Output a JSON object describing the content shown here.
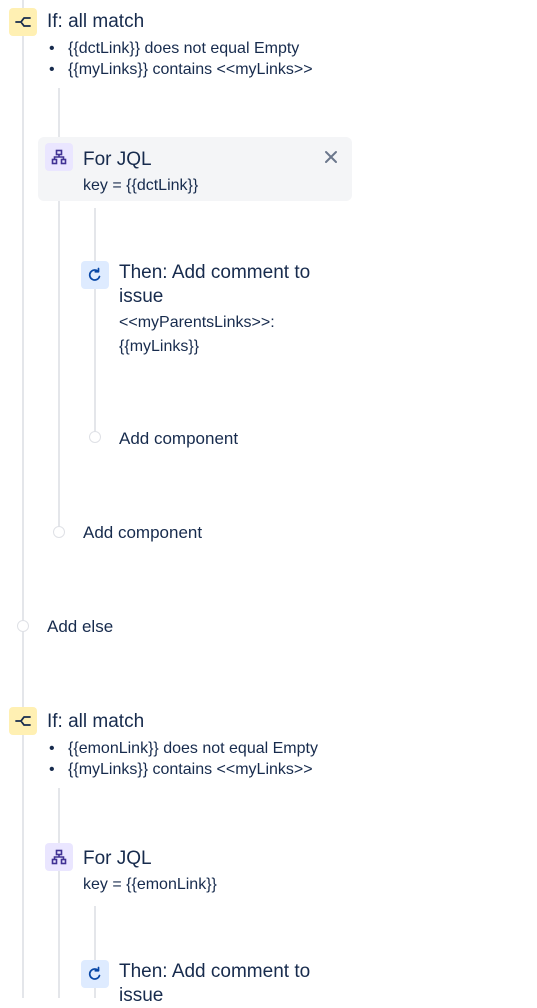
{
  "block1": {
    "title": "If: all match",
    "conditions": [
      "{{dctLink}} does not equal Empty",
      "{{myLinks}} contains <<myLinks>>"
    ],
    "for_title": "For JQL",
    "for_sub": "key = {{dctLink}}",
    "then_title_1": "Then: Add comment to",
    "then_title_2": "issue",
    "then_body_1": "<<myParentsLinks>>:",
    "then_body_2": "{{myLinks}}",
    "add_component_inner": "Add component",
    "add_component_outer": "Add component",
    "add_else": "Add else"
  },
  "block2": {
    "title": "If: all match",
    "conditions": [
      "{{emonLink}} does not equal Empty",
      "{{myLinks}} contains <<myLinks>>"
    ],
    "for_title": "For JQL",
    "for_sub": "key = {{emonLink}}",
    "then_title_1": "Then: Add comment to",
    "then_title_2": "issue"
  },
  "icons": {
    "condition": "branch-condition-icon",
    "for": "hierarchy-icon",
    "action": "refresh-action-icon",
    "close": "close-icon"
  },
  "colors": {
    "condition_bg": "#fff0b3",
    "for_bg": "#eae6ff",
    "action_bg": "#deebff",
    "selected_bg": "#f4f5f7",
    "line": "#e4e6ea",
    "text": "#172b4d"
  }
}
